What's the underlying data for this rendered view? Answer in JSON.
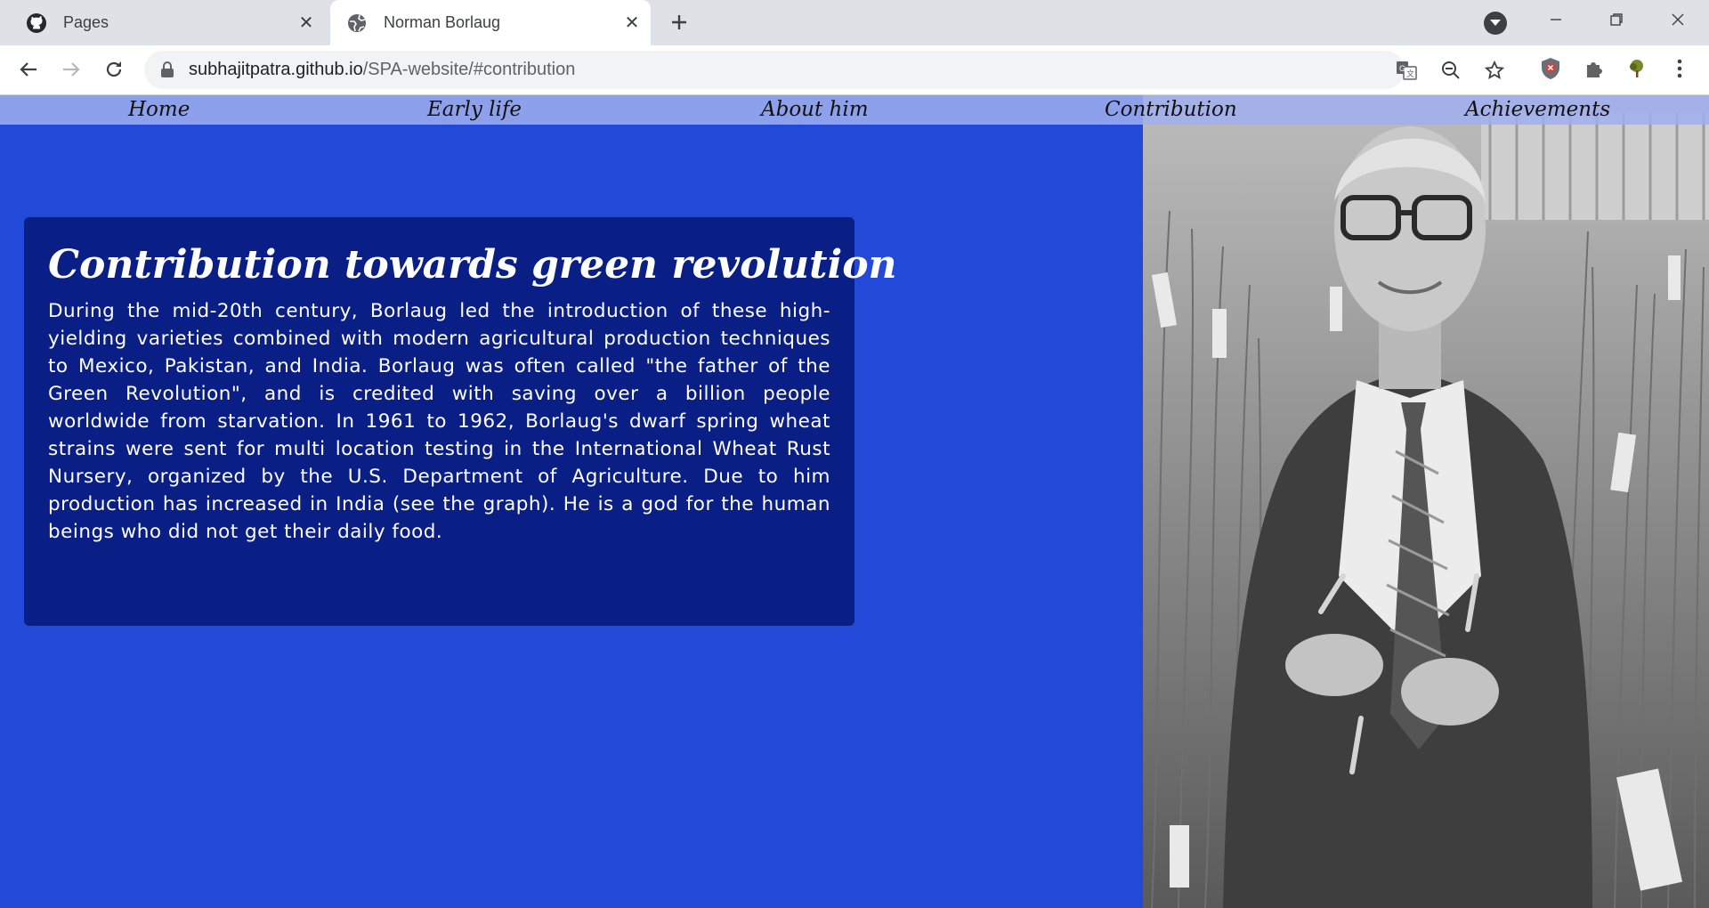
{
  "browser": {
    "tabs": [
      {
        "title": "Pages",
        "icon": "github-icon",
        "active": false
      },
      {
        "title": "Norman Borlaug",
        "icon": "globe-icon",
        "active": true
      }
    ],
    "address": {
      "host": "subhajitpatra.github.io",
      "path": "/SPA-website/#contribution"
    }
  },
  "nav": {
    "items": [
      {
        "label": "Home"
      },
      {
        "label": "Early life"
      },
      {
        "label": "About him"
      },
      {
        "label": "Contribution"
      },
      {
        "label": "Achievements"
      }
    ]
  },
  "section": {
    "heading": "Contribution towards green revolution",
    "body": "During the mid-20th century, Borlaug led the introduction of these high-yielding varieties combined with modern agricultural production techniques to Mexico, Pakistan, and India. Borlaug was often called \"the father of the Green Revolution\", and is credited with saving over a billion people worldwide from starvation. In 1961 to 1962, Borlaug's dwarf spring wheat strains were sent for multi location testing in the International Wheat Rust Nursery, organized by the U.S. Department of Agriculture. Due to him production has increased in India (see the graph). He is a god for the human beings who did not get their daily food."
  },
  "colors": {
    "page_background": "#2349d8",
    "card_background": "#0a1f86",
    "nav_background": "#a0aff0"
  }
}
